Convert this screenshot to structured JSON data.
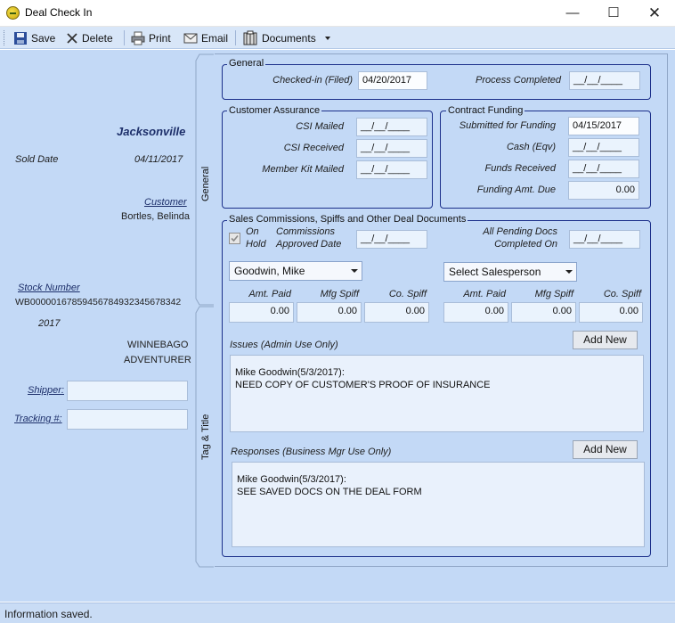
{
  "window": {
    "title": "Deal Check In"
  },
  "toolbar": {
    "save": "Save",
    "delete": "Delete",
    "print": "Print",
    "email": "Email",
    "documents": "Documents"
  },
  "sidebar": {
    "location": "Jacksonville",
    "sold_date_label": "Sold Date",
    "sold_date": "04/11/2017",
    "customer_label": "Customer",
    "customer": "Bortles, Belinda",
    "stock_label": "Stock Number",
    "stock_number": "WB00000167859456784932345678342",
    "year": "2017",
    "make": "WINNEBAGO",
    "model": "ADVENTURER",
    "shipper_label": "Shipper:",
    "tracking_label": "Tracking #:"
  },
  "tabs": {
    "general": "General",
    "tag_title": "Tag & Title"
  },
  "general": {
    "title": "General",
    "checked_in_label": "Checked-in (Filed)",
    "checked_in": "04/20/2017",
    "process_label": "Process Completed",
    "process": "__/__/____"
  },
  "customer_assurance": {
    "title": "Customer Assurance",
    "csi_mailed_label": "CSI Mailed",
    "csi_mailed": "__/__/____",
    "csi_received_label": "CSI Received",
    "csi_received": "__/__/____",
    "member_kit_label": "Member Kit Mailed",
    "member_kit": "__/__/____"
  },
  "contract_funding": {
    "title": "Contract Funding",
    "submitted_label": "Submitted for Funding",
    "submitted": "04/15/2017",
    "cash_label": "Cash (Eqv)",
    "cash": "__/__/____",
    "funds_label": "Funds Received",
    "funds": "__/__/____",
    "amt_due_label": "Funding Amt. Due",
    "amt_due": "0.00"
  },
  "commissions": {
    "title": "Sales Commissions, Spiffs and Other Deal Documents",
    "on_hold_label_1": "On",
    "on_hold_label_2": "Hold",
    "approved_label_1": "Commissions",
    "approved_label_2": "Approved Date",
    "approved": "__/__/____",
    "pending_label_1": "All Pending Docs",
    "pending_label_2": "Completed On",
    "pending": "__/__/____",
    "salesperson1": "Goodwin, Mike",
    "salesperson2": "Select Salesperson",
    "col_amt_paid": "Amt. Paid",
    "col_mfg_spiff": "Mfg Spiff",
    "col_co_spiff": "Co. Spiff",
    "sp1_amt_paid": "0.00",
    "sp1_mfg_spiff": "0.00",
    "sp1_co_spiff": "0.00",
    "sp2_amt_paid": "0.00",
    "sp2_mfg_spiff": "0.00",
    "sp2_co_spiff": "0.00",
    "issues_label": "Issues (Admin Use Only)",
    "issues_add": "Add New",
    "issues_text": "Mike Goodwin(5/3/2017):\nNEED COPY OF CUSTOMER'S PROOF OF INSURANCE",
    "responses_label": "Responses (Business Mgr Use Only)",
    "responses_add": "Add New",
    "responses_text": "Mike Goodwin(5/3/2017):\nSEE SAVED DOCS ON THE DEAL FORM"
  },
  "status": {
    "text": "Information saved."
  },
  "colors": {
    "accent": "#1b2f8a",
    "background": "#c3d9f6",
    "toolbar": "#d8e6f8"
  }
}
